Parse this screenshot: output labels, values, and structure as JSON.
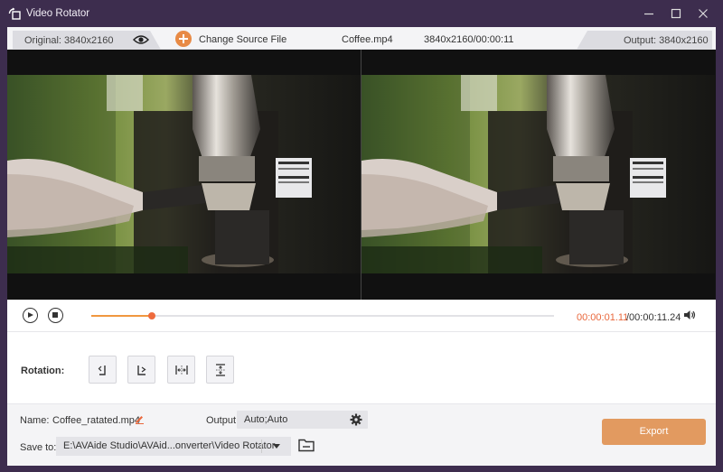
{
  "window": {
    "title": "Video Rotator",
    "icon": "rotate-app-icon",
    "controls": [
      "minimize-icon",
      "maximize-icon",
      "close-icon"
    ]
  },
  "infobar": {
    "original": "Original: 3840x2160",
    "change_source": "Change Source File",
    "file_name": "Coffee.mp4",
    "file_info": "3840x2160/00:00:11",
    "output": "Output: 3840x2160"
  },
  "playback": {
    "current_time": "00:00:01.11",
    "total_time": "/00:00:11.24",
    "progress": 0.13
  },
  "rotation": {
    "label": "Rotation:",
    "buttons": [
      "rotate-left-icon",
      "rotate-right-icon",
      "flip-horizontal-icon",
      "flip-vertical-icon"
    ]
  },
  "bottom": {
    "name_label": "Name:",
    "name_value": "Coffee_ratated.mp4",
    "output_label": "Output:",
    "output_value": "Auto;Auto",
    "save_label": "Save to:",
    "save_path": "E:\\AVAide Studio\\AVAid...onverter\\Video Rotator",
    "export_label": "Export"
  },
  "colors": {
    "titlebar": "#3d2d4e",
    "accent": "#e88a45",
    "time_current": "#e9673b",
    "export": "#e29a60"
  }
}
